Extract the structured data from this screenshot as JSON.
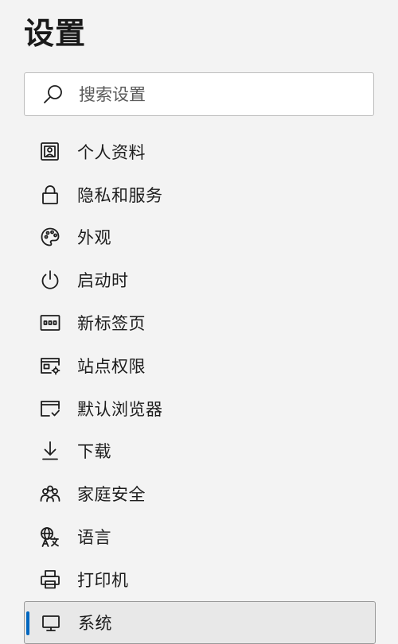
{
  "page": {
    "title": "设置"
  },
  "search": {
    "placeholder": "搜索设置"
  },
  "nav": {
    "items": [
      {
        "label": "个人资料",
        "icon": "profile-icon"
      },
      {
        "label": "隐私和服务",
        "icon": "lock-icon"
      },
      {
        "label": "外观",
        "icon": "palette-icon"
      },
      {
        "label": "启动时",
        "icon": "power-icon"
      },
      {
        "label": "新标签页",
        "icon": "new-tab-icon"
      },
      {
        "label": "站点权限",
        "icon": "site-permissions-icon"
      },
      {
        "label": "默认浏览器",
        "icon": "default-browser-icon"
      },
      {
        "label": "下载",
        "icon": "download-icon"
      },
      {
        "label": "家庭安全",
        "icon": "family-icon"
      },
      {
        "label": "语言",
        "icon": "language-icon"
      },
      {
        "label": "打印机",
        "icon": "printer-icon"
      },
      {
        "label": "系统",
        "icon": "system-icon",
        "selected": true
      }
    ]
  },
  "colors": {
    "accent": "#0067c0",
    "background": "#f3f3f3"
  }
}
